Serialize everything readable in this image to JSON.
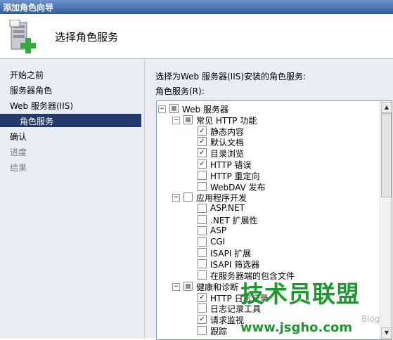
{
  "window": {
    "title": "添加角色向导"
  },
  "header": {
    "heading": "选择角色服务",
    "icon": "server-add-icon"
  },
  "nav": {
    "items": [
      {
        "label": "开始之前",
        "state": "normal"
      },
      {
        "label": "服务器角色",
        "state": "normal"
      },
      {
        "label": "Web 服务器(IIS)",
        "state": "normal"
      },
      {
        "label": "角色服务",
        "state": "selected"
      },
      {
        "label": "确认",
        "state": "normal"
      },
      {
        "label": "进度",
        "state": "disabled"
      },
      {
        "label": "结果",
        "state": "disabled"
      }
    ]
  },
  "main": {
    "description": "选择为Web 服务器(IIS)安装的角色服务:",
    "services_label": "角色服务(R):",
    "tree": [
      {
        "label": "Web 服务器",
        "level": 0,
        "expander": "⊟",
        "state": "partial"
      },
      {
        "label": "常见 HTTP 功能",
        "level": 1,
        "expander": "⊟",
        "state": "partial"
      },
      {
        "label": "静态内容",
        "level": 2,
        "state": "checked"
      },
      {
        "label": "默认文档",
        "level": 2,
        "state": "checked"
      },
      {
        "label": "目录浏览",
        "level": 2,
        "state": "checked"
      },
      {
        "label": "HTTP 错误",
        "level": 2,
        "state": "checked"
      },
      {
        "label": "HTTP 重定向",
        "level": 2,
        "state": "unchecked"
      },
      {
        "label": "WebDAV 发布",
        "level": 2,
        "state": "unchecked"
      },
      {
        "label": "应用程序开发",
        "level": 1,
        "expander": "⊟",
        "state": "unchecked"
      },
      {
        "label": "ASP.NET",
        "level": 2,
        "state": "unchecked"
      },
      {
        "label": ".NET 扩展性",
        "level": 2,
        "state": "unchecked"
      },
      {
        "label": "ASP",
        "level": 2,
        "state": "unchecked"
      },
      {
        "label": "CGI",
        "level": 2,
        "state": "unchecked"
      },
      {
        "label": "ISAPI 扩展",
        "level": 2,
        "state": "unchecked"
      },
      {
        "label": "ISAPI 筛选器",
        "level": 2,
        "state": "unchecked"
      },
      {
        "label": "在服务器端的包含文件",
        "level": 2,
        "state": "unchecked"
      },
      {
        "label": "健康和诊断",
        "level": 1,
        "expander": "⊟",
        "state": "partial"
      },
      {
        "label": "HTTP 日志记录",
        "level": 2,
        "state": "checked"
      },
      {
        "label": "日志记录工具",
        "level": 2,
        "state": "unchecked"
      },
      {
        "label": "请求监视",
        "level": 2,
        "state": "checked"
      },
      {
        "label": "跟踪",
        "level": 2,
        "state": "unchecked"
      }
    ],
    "scroll_up": "▲",
    "scroll_down": "▼"
  },
  "watermark": {
    "text": "技术员联盟",
    "url": "www.jsgho.com",
    "blog": "Blog"
  },
  "colors": {
    "nav_selected_bg": "#233a6b",
    "panel_bg": "#eaeef3",
    "watermark_green": "#1b9a2c"
  }
}
